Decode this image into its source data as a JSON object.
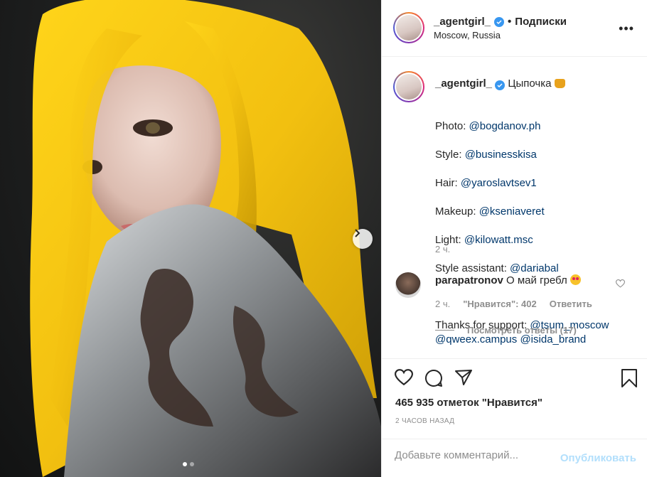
{
  "post": {
    "username": "_agentgirl_",
    "follow_label": "Подписки",
    "location": "Moscow, Russia",
    "more_label": "•••"
  },
  "caption": {
    "username": "_agentgirl_",
    "headline": "Цыпочка",
    "lines": [
      {
        "label": "Photo: ",
        "mention": "@bogdanov.ph"
      },
      {
        "label": "Style: ",
        "mention": "@businesskisa"
      },
      {
        "label": "Hair: ",
        "mention": "@yaroslavtsev1"
      },
      {
        "label": "Makeup: ",
        "mention": "@kseniaveret"
      },
      {
        "label": "Light: ",
        "mention": "@kilowatt.msc"
      },
      {
        "label": "Style assistant: ",
        "mention": "@dariabal"
      }
    ],
    "thanks_label": "Thanks for support: ",
    "thanks_mentions": [
      "@tsum_moscow",
      "@qweex.campus",
      "@isida_brand"
    ],
    "time": "2 ч."
  },
  "comment": {
    "username": "parapatronov",
    "text": "О май гребл",
    "time": "2 ч.",
    "likes": "\"Нравится\": 402",
    "reply_label": "Ответить",
    "view_replies": "Посмотреть ответы (17)"
  },
  "stats": {
    "likes": "465 935 отметок \"Нравится\"",
    "date": "2 ЧАСОВ НАЗАД"
  },
  "composer": {
    "placeholder": "Добавьте комментарий...",
    "publish_label": "Опубликовать"
  },
  "carousel": {
    "current": 1,
    "total": 2
  },
  "colors": {
    "verified": "#3897f0",
    "mention": "#00376b",
    "hair": "#f4c20d",
    "publish_disabled": "#b2dffc"
  },
  "icons": [
    "heart-icon",
    "comment-icon",
    "share-icon",
    "bookmark-icon",
    "chevron-right-icon",
    "verified-icon",
    "more-icon"
  ]
}
